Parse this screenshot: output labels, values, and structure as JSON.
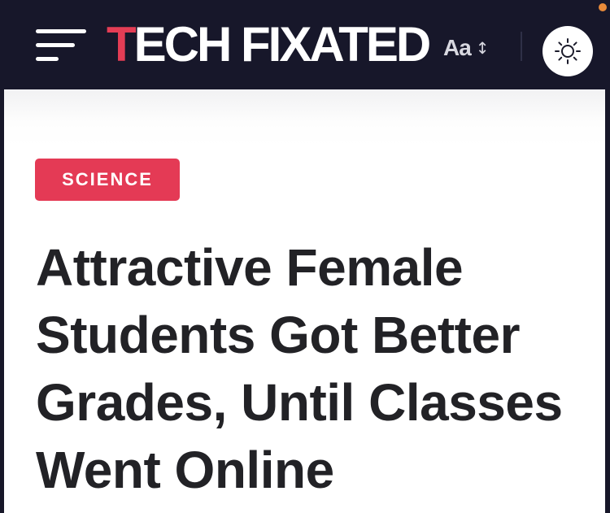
{
  "header": {
    "logo_first_letter": "T",
    "logo_rest": "ECH FIXATED",
    "font_size_label": "Aa",
    "font_size_arrows": "↕",
    "accent_color": "#e43d55",
    "background_color": "#17172a"
  },
  "icons": {
    "menu": "hamburger-menu-icon",
    "font_size": "font-size-toggle-icon",
    "theme": "sun-icon"
  },
  "article": {
    "category": "SCIENCE",
    "category_color": "#e43a55",
    "title": "Attractive Female Students Got Better Grades, Until Classes Went Online"
  }
}
